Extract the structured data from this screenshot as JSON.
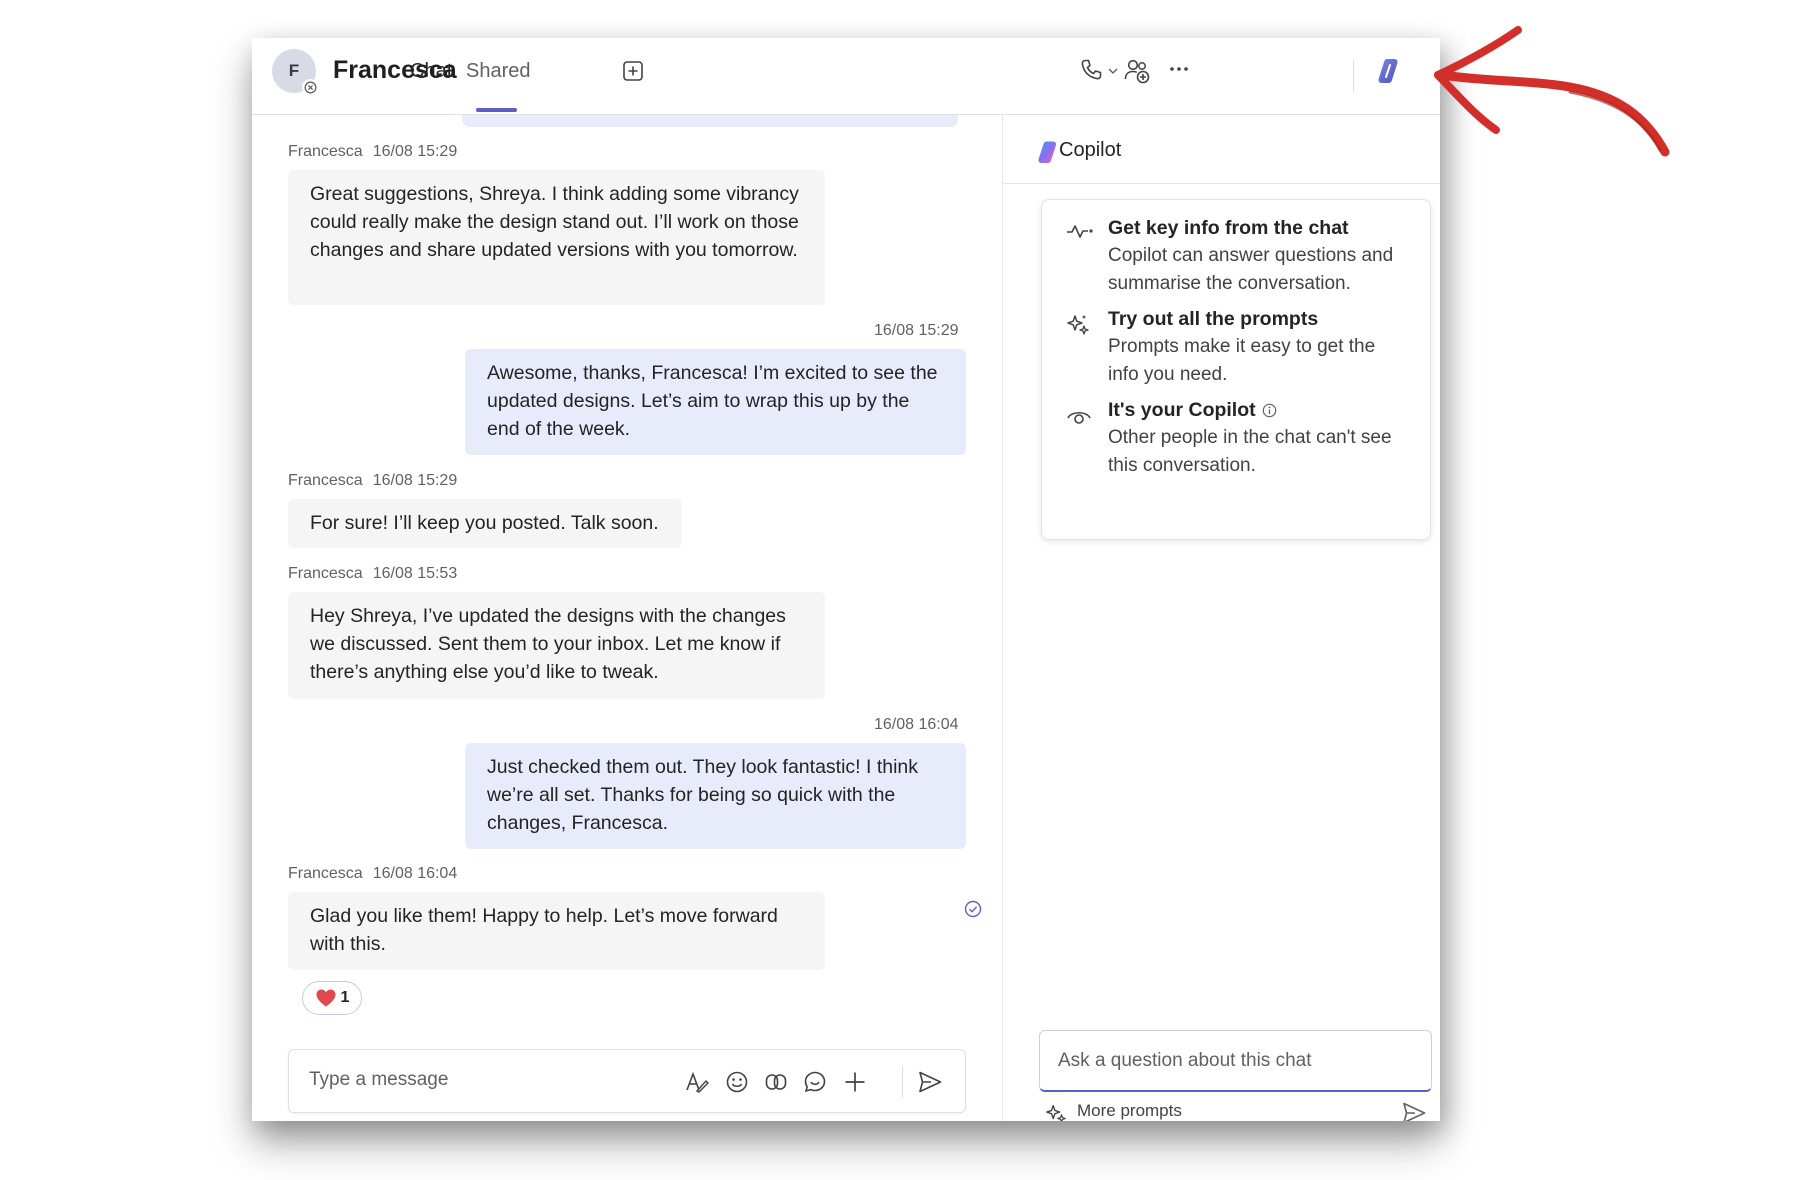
{
  "header": {
    "avatar_initial": "F",
    "contact_name": "Francesca",
    "tabs": [
      {
        "label": "Chat",
        "active": true
      },
      {
        "label": "Shared",
        "active": false
      }
    ]
  },
  "messages": [
    {
      "sender": "Francesca",
      "time": "16/08 15:29",
      "outgoing": false,
      "text": "Great suggestions, Shreya. I think adding some vibrancy could really make the design stand out. I’ll work on those changes and share updated versions with you tomorrow."
    },
    {
      "sender": "",
      "time": "16/08 15:29",
      "outgoing": true,
      "text": "Awesome, thanks, Francesca! I’m excited to see the updated designs. Let’s aim to wrap this up by the end of the week."
    },
    {
      "sender": "Francesca",
      "time": "16/08 15:29",
      "outgoing": false,
      "text": "For sure! I’ll keep you posted. Talk soon."
    },
    {
      "sender": "Francesca",
      "time": "16/08 15:53",
      "outgoing": false,
      "text": "Hey Shreya, I’ve updated the designs with the changes we discussed. Sent them to your inbox. Let me know if there’s anything else you’d like to tweak."
    },
    {
      "sender": "",
      "time": "16/08 16:04",
      "outgoing": true,
      "text": "Just checked them out. They look fantastic! I think we’re all set. Thanks for being so quick with the changes, Francesca."
    },
    {
      "sender": "Francesca",
      "time": "16/08 16:04",
      "outgoing": false,
      "text": "Glad you like them! Happy to help. Let’s move forward with this."
    }
  ],
  "reaction": {
    "emoji": "heart",
    "count": "1"
  },
  "compose": {
    "placeholder": "Type a message"
  },
  "copilot": {
    "title": "Copilot",
    "features": [
      {
        "icon": "key-info-icon",
        "title": "Get key info from the chat",
        "desc": "Copilot can answer questions and summarise the conversation."
      },
      {
        "icon": "sparkle-icon",
        "title": "Try out all the prompts",
        "desc": "Prompts make it easy to get the info you need."
      },
      {
        "icon": "eye-icon",
        "title": "It's your Copilot",
        "desc": "Other people in the chat can't see this conversation."
      }
    ],
    "ask_placeholder": "Ask a question about this chat",
    "more_prompts": "More prompts"
  },
  "colors": {
    "accent": "#5b5fc7",
    "arrow": "#d32f2a",
    "outgoing_bubble": "#e8ebfa",
    "incoming_bubble": "#f5f5f5"
  }
}
